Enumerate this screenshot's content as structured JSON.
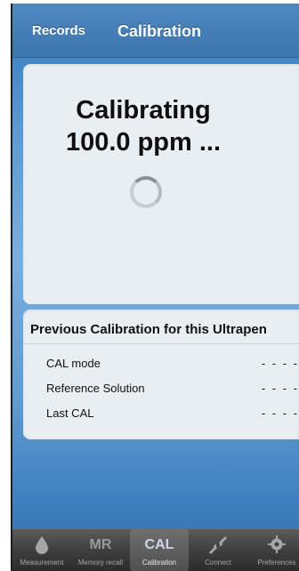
{
  "navbar": {
    "back_label": "Records",
    "title": "Calibration"
  },
  "status": {
    "line1": "Calibrating",
    "line2": "100.0 ppm ..."
  },
  "previous": {
    "title": "Previous Calibration for this Ultrapen",
    "rows": [
      {
        "label": "CAL mode",
        "value": "- - - -"
      },
      {
        "label": "Reference Solution",
        "value": "- - - -"
      },
      {
        "label": "Last CAL",
        "value": "- - - -"
      }
    ]
  },
  "tabs": [
    {
      "label": "Measurement",
      "icon_text": "",
      "icon": "drop-icon",
      "active": false
    },
    {
      "label": "Memory recall",
      "icon_text": "MR",
      "icon": "mr-text-icon",
      "active": false
    },
    {
      "label": "Calibration",
      "icon_text": "CAL",
      "icon": "cal-text-icon",
      "active": true
    },
    {
      "label": "Connect",
      "icon_text": "",
      "icon": "connect-arrows-icon",
      "active": false
    },
    {
      "label": "Preferences",
      "icon_text": "",
      "icon": "gear-icon",
      "active": false
    }
  ],
  "colors": {
    "accent": "#3d76ae",
    "tabbar": "#3f3f3f"
  }
}
